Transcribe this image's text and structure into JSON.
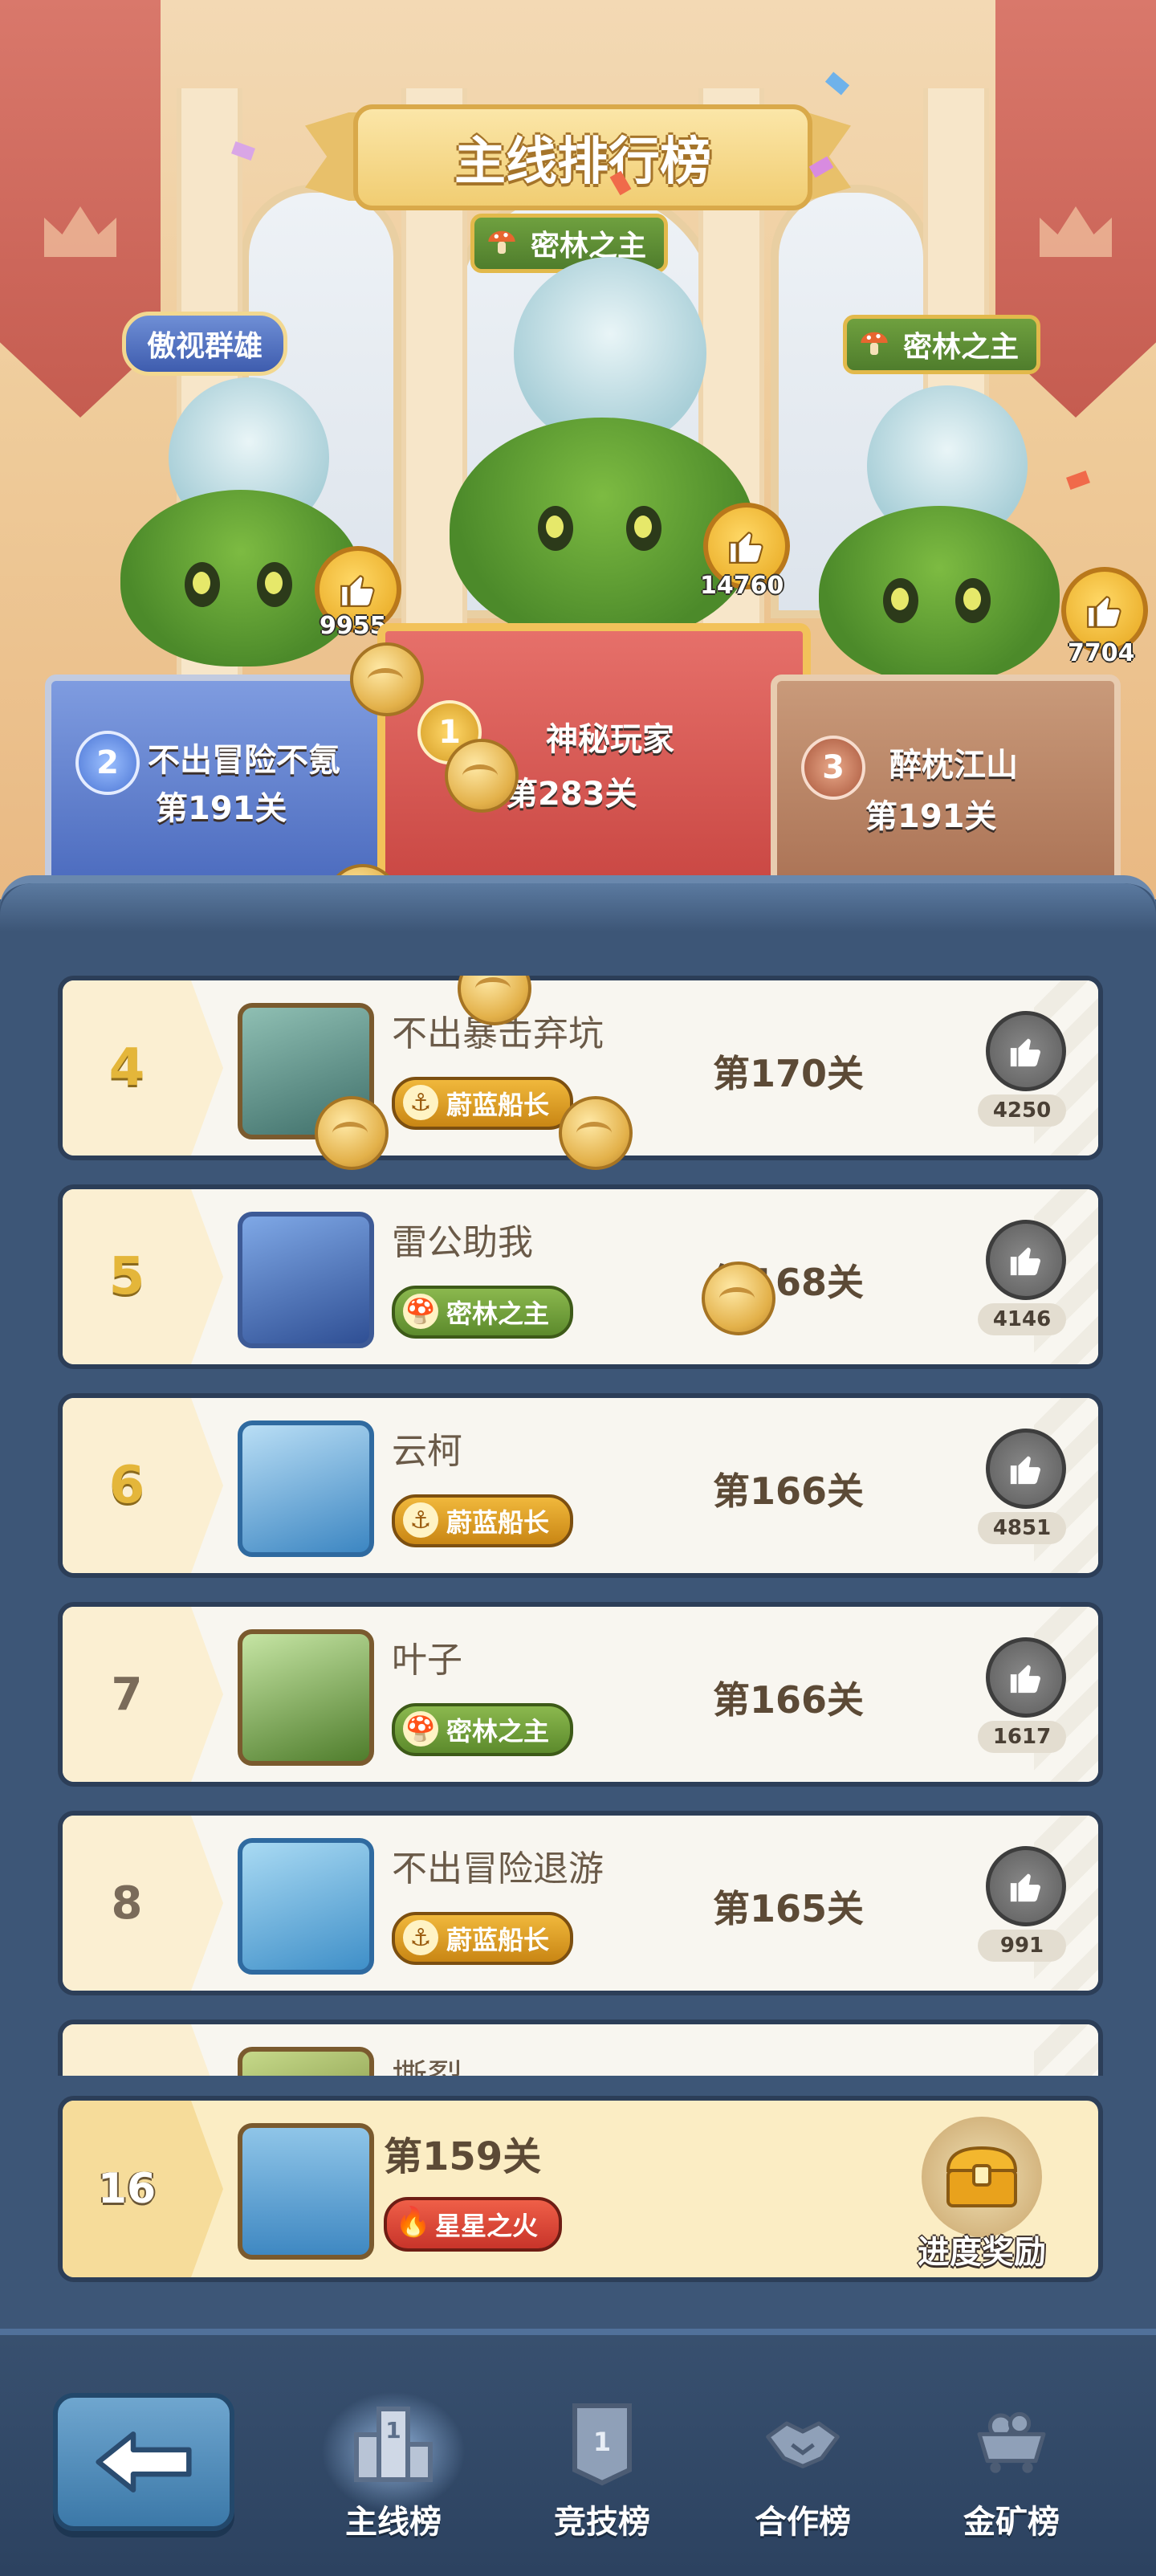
{
  "header": {
    "title": "主线排行榜"
  },
  "podium": [
    {
      "rank": "2",
      "name": "不出冒险不氪",
      "level": "第191关",
      "likes": "9955",
      "title": "傲视群雄",
      "title_style": "blue"
    },
    {
      "rank": "1",
      "name": "神秘玩家",
      "level": "第283关",
      "likes": "14760",
      "title": "密林之主",
      "title_style": "green"
    },
    {
      "rank": "3",
      "name": "醉枕江山",
      "level": "第191关",
      "likes": "7704",
      "title": "密林之主",
      "title_style": "green"
    }
  ],
  "rows": [
    {
      "rank": "4",
      "name": "不出暴击弃坑",
      "title": "蔚蓝船长",
      "title_style": "gold",
      "level": "第170关",
      "likes": "4250",
      "avatar_color": "#4e8a7a"
    },
    {
      "rank": "5",
      "name": "雷公助我",
      "title": "密林之主",
      "title_style": "green",
      "level": "第168关",
      "likes": "4146",
      "avatar_color": "#3f6fb4"
    },
    {
      "rank": "6",
      "name": "云柯",
      "title": "蔚蓝船长",
      "title_style": "gold",
      "level": "第166关",
      "likes": "4851",
      "avatar_color": "#4f9bd0"
    },
    {
      "rank": "7",
      "name": "叶子",
      "title": "密林之主",
      "title_style": "green",
      "level": "第166关",
      "likes": "1617",
      "avatar_color": "#6f9a3e"
    },
    {
      "rank": "8",
      "name": "不出冒险退游",
      "title": "蔚蓝船长",
      "title_style": "gold",
      "level": "第165关",
      "likes": "991",
      "avatar_color": "#e08a3a"
    },
    {
      "rank": "",
      "name": "撕裂",
      "title": "",
      "title_style": "gold",
      "level": "",
      "likes": "",
      "avatar_color": "#7a8a3e"
    }
  ],
  "my_rank": {
    "rank": "16",
    "level": "第159关",
    "title": "星星之火",
    "reward_label": "进度奖励"
  },
  "nav": [
    {
      "label": "主线榜",
      "icon": "podium-icon",
      "active": true
    },
    {
      "label": "竞技榜",
      "icon": "arena-banner-icon",
      "active": false
    },
    {
      "label": "合作榜",
      "icon": "handshake-icon",
      "active": false
    },
    {
      "label": "金矿榜",
      "icon": "mine-cart-icon",
      "active": false
    }
  ]
}
